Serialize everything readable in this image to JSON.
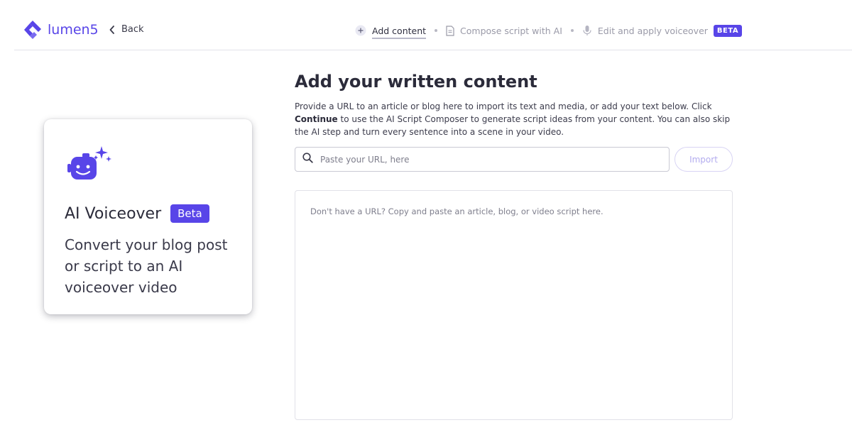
{
  "brand": {
    "name": "lumen5",
    "color": "#5845e8"
  },
  "nav": {
    "back_label": "Back",
    "back_icon": "chevron-left-icon"
  },
  "steps": [
    {
      "label": "Add content",
      "icon": "plus-circle-icon",
      "active": true
    },
    {
      "label": "Compose script with AI",
      "icon": "document-icon",
      "active": false
    },
    {
      "label": "Edit and apply voiceover",
      "icon": "microphone-icon",
      "active": false,
      "badge": "BETA"
    }
  ],
  "card": {
    "icon": "ai-robot-sparkle-icon",
    "title": "AI Voiceover",
    "badge": "Beta",
    "description": "Convert your blog post or script to an AI voiceover video"
  },
  "main": {
    "title": "Add your written content",
    "intro_part1": "Provide a URL to an article or blog here to import its text and media, or add your text below. Click",
    "intro_bold": "Continue",
    "intro_part2": "to use the AI Script Composer to generate script ideas from your content. You can also skip the AI step and turn every sentence into a scene in your video.",
    "url_placeholder": "Paste your URL, here",
    "url_value": "",
    "import_label": "Import",
    "text_placeholder": "Don't have a URL? Copy and paste an article, blog, or video script here.",
    "text_value": ""
  }
}
